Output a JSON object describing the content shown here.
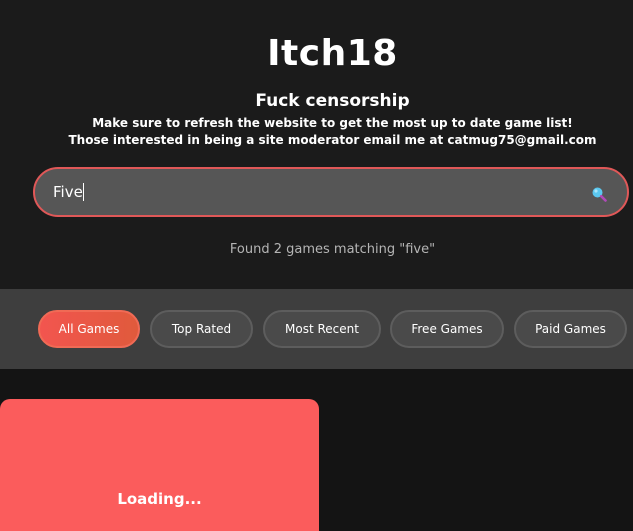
{
  "header": {
    "title": "Itch18",
    "tagline": "Fuck censorship",
    "notice_refresh": "Make sure to refresh the website to get the most up to date game list!",
    "notice_moderator": "Those interested in being a site moderator email me at catmug75@gmail.com"
  },
  "search": {
    "value": "Five",
    "icon": "magnifier-icon",
    "result_text": "Found 2 games matching \"five\""
  },
  "filters": [
    {
      "label": "All Games",
      "active": true
    },
    {
      "label": "Top Rated",
      "active": false
    },
    {
      "label": "Most Recent",
      "active": false
    },
    {
      "label": "Free Games",
      "active": false
    },
    {
      "label": "Paid Games",
      "active": false
    }
  ],
  "games": [
    {
      "status": "Loading..."
    }
  ],
  "colors": {
    "accent": "#fb5c5c",
    "search_border": "#e05858",
    "background": "#1b1b1b",
    "filter_bar": "#3e3e3e"
  }
}
